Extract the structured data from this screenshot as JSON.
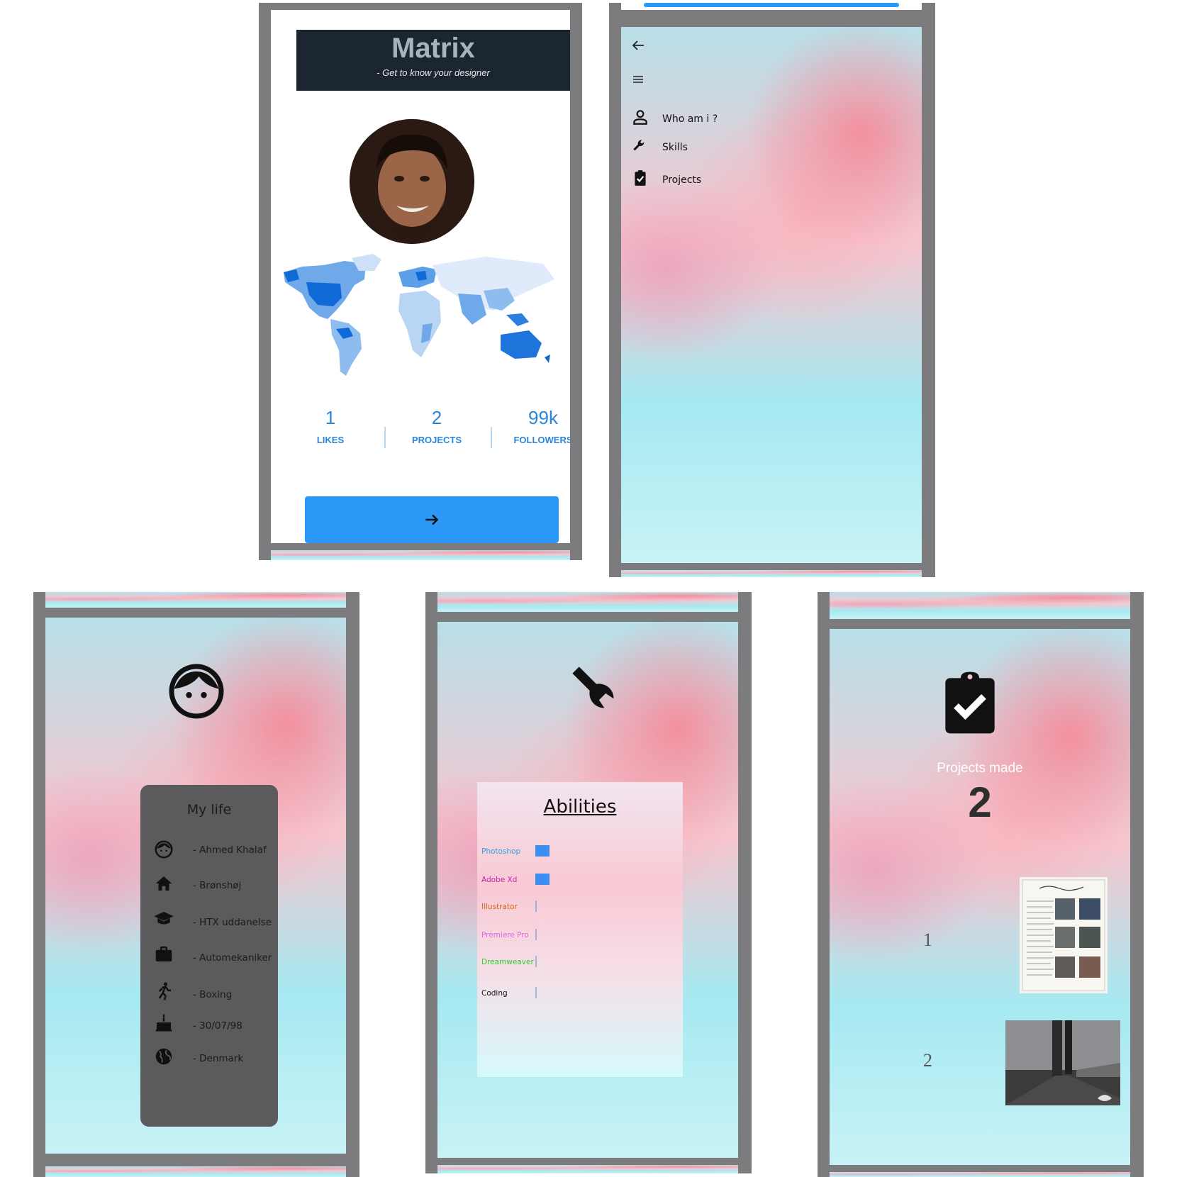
{
  "home": {
    "title": "Matrix",
    "subtitle": "- Get to know your designer",
    "stats": [
      {
        "value": "1",
        "label": "LIKES"
      },
      {
        "value": "2",
        "label": "PROJECTS"
      },
      {
        "value": "99k",
        "label": "FOLLOWERS"
      }
    ]
  },
  "menu": {
    "items": [
      {
        "label": "Who am i ?",
        "icon": "person-icon"
      },
      {
        "label": "Skills",
        "icon": "wrench-icon"
      },
      {
        "label": "Projects",
        "icon": "clipboard-check-icon"
      }
    ]
  },
  "about": {
    "title": "My life",
    "items": [
      {
        "icon": "face-icon",
        "text": "- Ahmed Khalaf"
      },
      {
        "icon": "home-icon",
        "text": "- Brønshøj"
      },
      {
        "icon": "graduation-cap-icon",
        "text": "- HTX uddanelse"
      },
      {
        "icon": "briefcase-icon",
        "text": "- Automekaniker"
      },
      {
        "icon": "running-icon",
        "text": "- Boxing"
      },
      {
        "icon": "cake-icon",
        "text": "- 30/07/98"
      },
      {
        "icon": "globe-icon",
        "text": "- Denmark"
      }
    ]
  },
  "skills": {
    "title": "Abilities",
    "items": [
      {
        "name": "Photoshop",
        "level": 1.0,
        "color": "#3a9be0"
      },
      {
        "name": "Adobe Xd",
        "level": 1.0,
        "color": "#c02aa6"
      },
      {
        "name": "Illustrator",
        "level": 0.1,
        "color": "#d2691e"
      },
      {
        "name": "Premiere Pro",
        "level": 0.1,
        "color": "#e066e0"
      },
      {
        "name": "Dreamweaver",
        "level": 0.05,
        "color": "#33cc33"
      },
      {
        "name": "Coding",
        "level": 0.05,
        "color": "#111111"
      }
    ]
  },
  "projects": {
    "label": "Projects made",
    "count": "2",
    "items": [
      {
        "number": "1"
      },
      {
        "number": "2"
      }
    ]
  },
  "colors": {
    "accent": "#2b97f6",
    "frame": "#7c7b7d",
    "header": "#1b2631"
  }
}
